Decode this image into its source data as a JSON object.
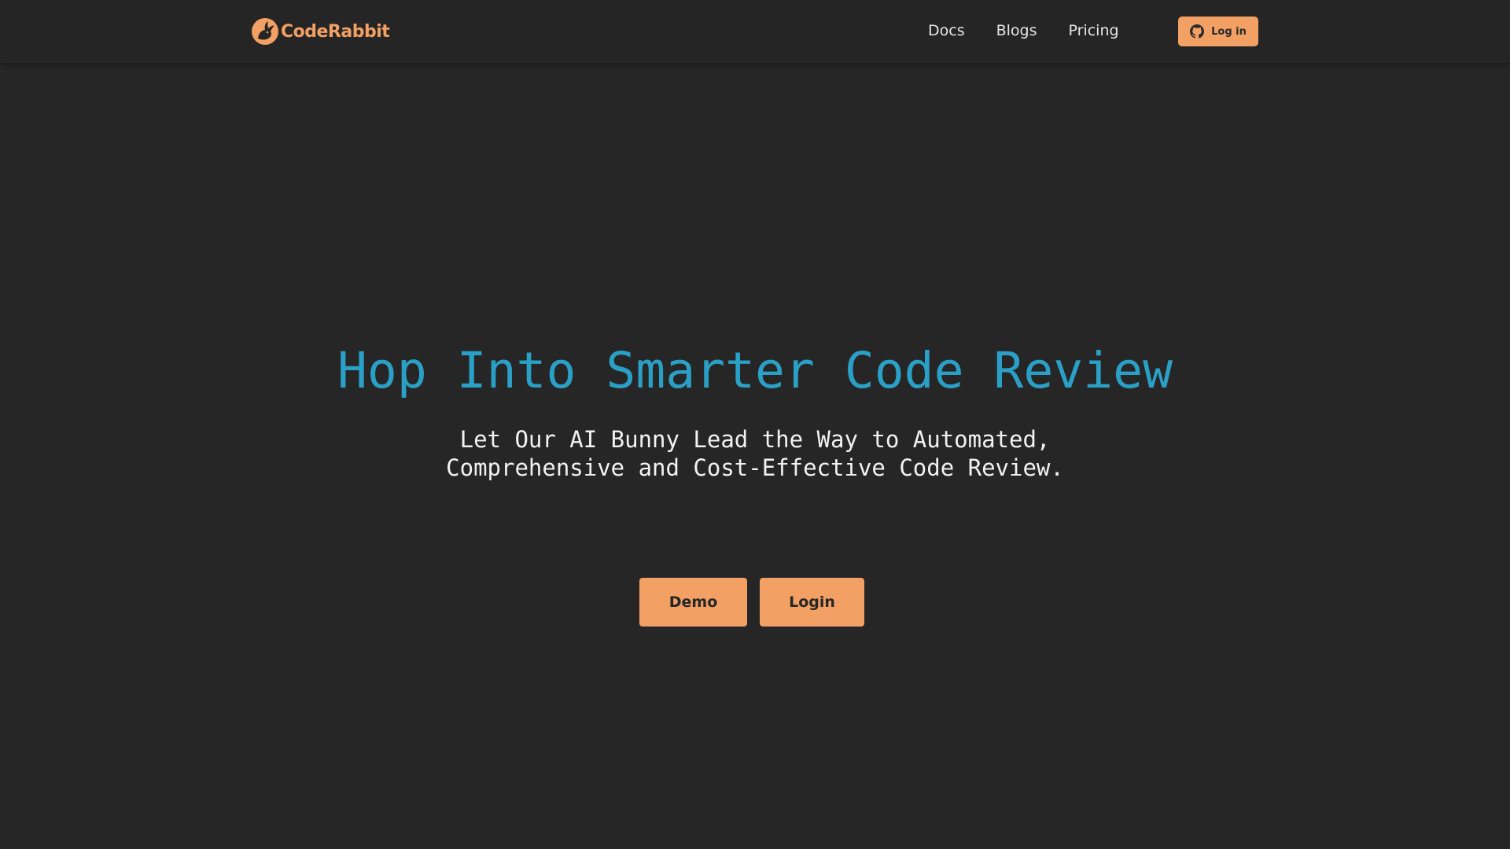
{
  "navbar": {
    "logo_text": "CodeRabbit",
    "logo_icon": "rabbit-logo-icon",
    "links": [
      {
        "label": "Docs"
      },
      {
        "label": "Blogs"
      },
      {
        "label": "Pricing"
      }
    ],
    "login_button": {
      "label": "Log in",
      "icon": "github-icon"
    }
  },
  "hero": {
    "title": "Hop Into Smarter Code Review",
    "subtitle_line1": "Let Our AI Bunny Lead the Way to Automated,",
    "subtitle_line2": "Comprehensive and Cost-Effective Code Review."
  },
  "cta": {
    "demo_label": "Demo",
    "login_label": "Login"
  },
  "colors": {
    "background": "#262626",
    "accent": "#f2a063",
    "title": "#2aa0c6",
    "text": "#f2f2f2"
  }
}
